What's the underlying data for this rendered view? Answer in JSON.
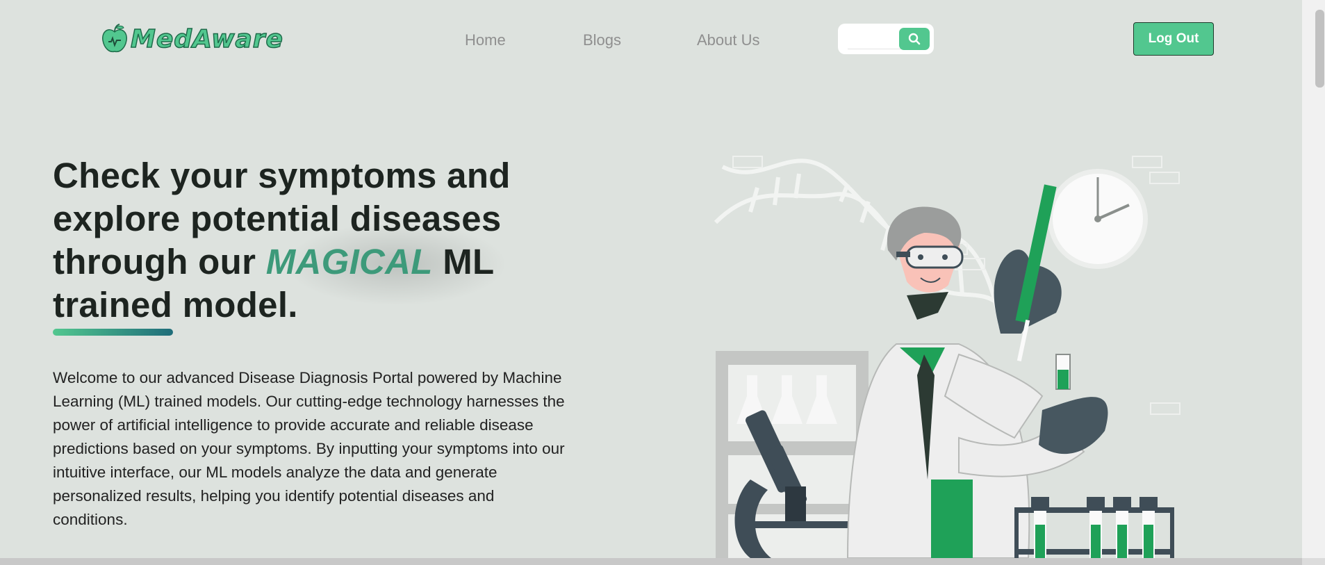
{
  "brand": {
    "name": "MedAware",
    "logo_icon": "apple-heart-icon",
    "color": "#52c78f"
  },
  "nav": {
    "items": [
      "Home",
      "Blogs",
      "About Us"
    ]
  },
  "search": {
    "placeholder": "",
    "button_icon": "search-icon"
  },
  "header": {
    "logout_label": "Log Out"
  },
  "hero": {
    "title_part1": "Check your symptoms and explore potential diseases through our ",
    "title_highlight": "MAGICAL",
    "title_part2": " ML trained model.",
    "intro": "Welcome to our advanced Disease Diagnosis Portal powered by Machine Learning (ML) trained models. Our cutting-edge technology harnesses the power of artificial intelligence to provide accurate and reliable disease predictions based on your symptoms. By inputting your symptoms into our intuitive interface, our ML models analyze the data and generate personalized results, helping you identify potential diseases and conditions."
  },
  "colors": {
    "accent": "#52c78f",
    "accent_dark": "#3d9a7a",
    "background": "#dde2de",
    "text": "#1d2420"
  },
  "illustration": {
    "name": "scientist-lab-illustration"
  }
}
